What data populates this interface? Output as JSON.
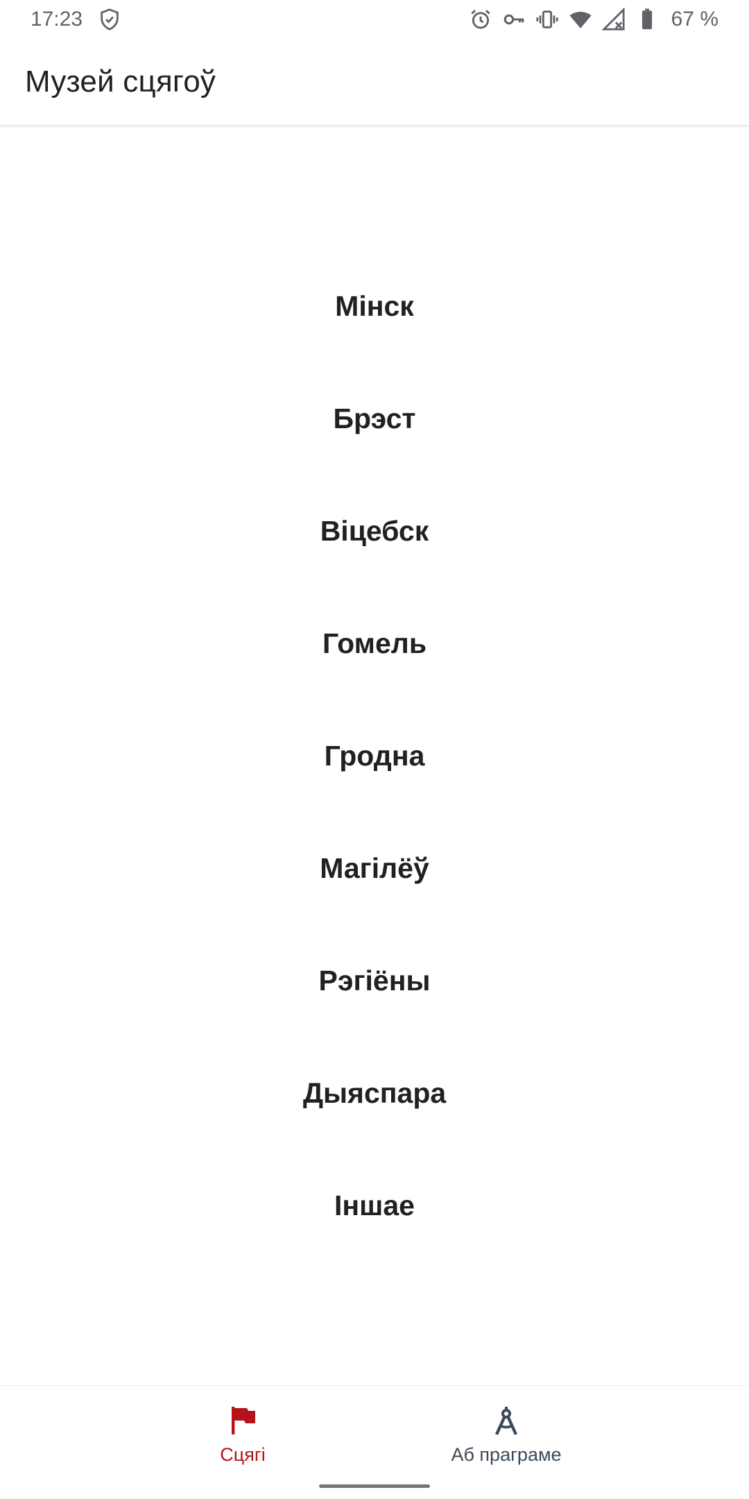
{
  "status_bar": {
    "time": "17:23",
    "battery": "67 %",
    "icons": [
      "shield-check-icon",
      "alarm-icon",
      "key-icon",
      "vibrate-icon",
      "wifi-icon",
      "no-signal-icon",
      "battery-icon"
    ]
  },
  "app_bar": {
    "title": "Музей сцягоў"
  },
  "regions": [
    {
      "label": "Мінск"
    },
    {
      "label": "Брэст"
    },
    {
      "label": "Віцебск"
    },
    {
      "label": "Гомель"
    },
    {
      "label": "Гродна"
    },
    {
      "label": "Магілёў"
    },
    {
      "label": "Рэгіёны"
    },
    {
      "label": "Дыяспара"
    },
    {
      "label": "Іншае"
    }
  ],
  "bottom_nav": {
    "items": [
      {
        "label": "Сцягі",
        "icon": "flag-icon",
        "active": true
      },
      {
        "label": "Аб праграме",
        "icon": "compass-icon",
        "active": false
      }
    ]
  },
  "colors": {
    "accent": "#b3131b",
    "inactive_nav": "#3c4a57",
    "text": "#212121",
    "status_text": "#5f6368"
  }
}
